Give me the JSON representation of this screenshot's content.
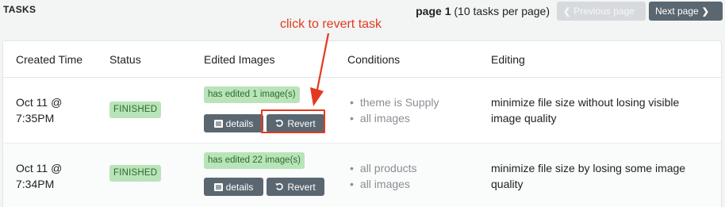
{
  "header": {
    "title": "TASKS",
    "pager": {
      "page_label": "page 1",
      "per_page_label": " (10 tasks per page)",
      "prev_label": "Previous page",
      "next_label": "Next page"
    }
  },
  "table": {
    "columns": [
      "Created Time",
      "Status",
      "Edited Images",
      "Conditions",
      "Editing"
    ],
    "rows": [
      {
        "created_line1": "Oct 11 @",
        "created_line2": "7:35PM",
        "status": "FINISHED",
        "edited": "has edited 1 image(s)",
        "details_label": "details",
        "revert_label": "Revert",
        "conditions": [
          "theme is Supply",
          "all images"
        ],
        "editing": "minimize file size without losing visible image quality"
      },
      {
        "created_line1": "Oct 11 @",
        "created_line2": "7:34PM",
        "status": "FINISHED",
        "edited": "has edited 22 image(s)",
        "details_label": "details",
        "revert_label": "Revert",
        "conditions": [
          "all products",
          "all images"
        ],
        "editing": "minimize file size by losing some image quality"
      }
    ]
  },
  "annotation": {
    "text": "click to revert task",
    "color": "#e33a1e"
  },
  "colors": {
    "button": "#5a6771",
    "badge_bg": "#b9e4b9",
    "badge_text": "#2b6b2b",
    "disabled_button": "#d7dadd"
  },
  "icons": {
    "prev": "chevron-left-icon",
    "next": "chevron-right-icon",
    "details": "list-icon",
    "revert": "undo-icon"
  }
}
